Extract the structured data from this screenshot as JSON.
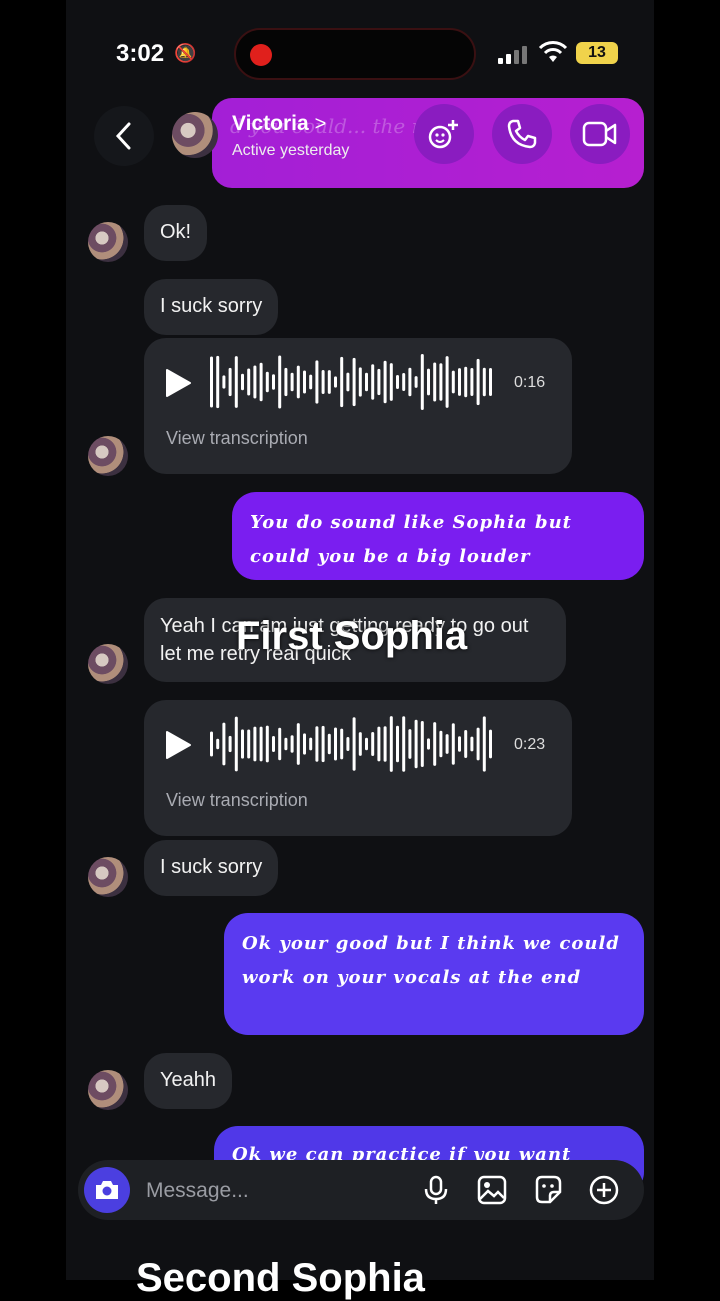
{
  "status": {
    "time": "3:02",
    "battery": "13"
  },
  "header": {
    "name": "Victoria",
    "name_chevron": ">",
    "active": "Active yesterday",
    "ghost_text": "d you could... the rest"
  },
  "messages": {
    "m1": "Ok!",
    "m2": "I suck sorry",
    "voice1": {
      "duration": "0:16",
      "transcription": "View transcription"
    },
    "out1": "You do sound like Sophia but could you be a big louder",
    "m3": "Yeah I can am just getting ready to go out let me retry real quick",
    "voice2": {
      "duration": "0:23",
      "transcription": "View transcription"
    },
    "m4": "I suck sorry",
    "out2": "Ok your good but I think we could work on your vocals at the end",
    "m5": "Yeahh",
    "out3": "Ok we can practice if you want"
  },
  "overlay": {
    "caption1": "First Sophia",
    "caption2": "Second Sophia"
  },
  "composer": {
    "placeholder": "Message..."
  },
  "colors": {
    "out1_bubble": "#7a1ef0",
    "out2_bubble": "#5a3af0",
    "incoming_bubble": "#26282d",
    "header_accent": "#a31fd6"
  },
  "icons": [
    "back-arrow-icon",
    "effects-icon",
    "phone-icon",
    "video-icon",
    "play-icon",
    "camera-icon",
    "microphone-icon",
    "gallery-icon",
    "sticker-icon",
    "plus-icon"
  ]
}
